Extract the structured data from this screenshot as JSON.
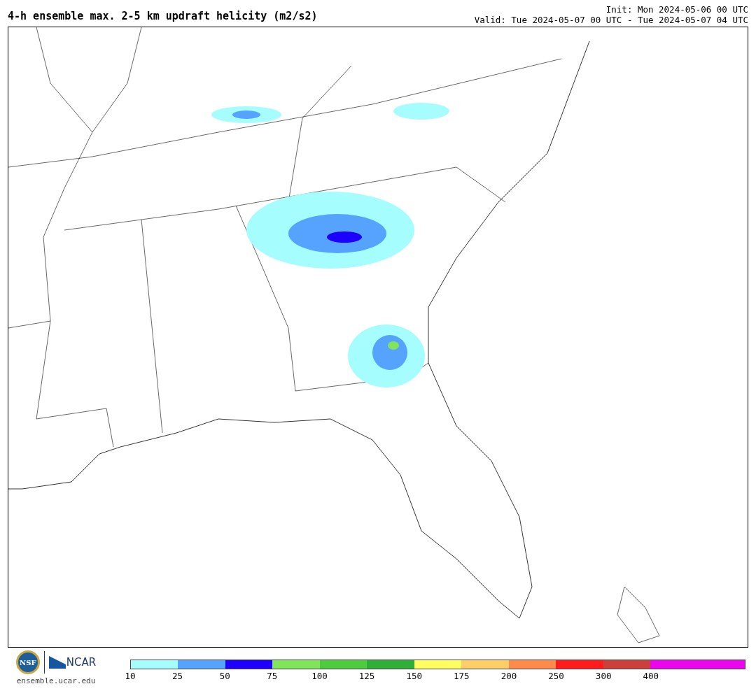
{
  "title": "4-h ensemble max. 2-5 km updraft helicity (m2/s2)",
  "init": "Init: Mon 2024-05-06 00 UTC",
  "valid": "Valid: Tue 2024-05-07 00 UTC - Tue 2024-05-07 04 UTC",
  "logos": {
    "nsf": "NSF",
    "ncar": "NCAR",
    "url": "ensemble.ucar.edu"
  },
  "colorbar": [
    {
      "label": "10",
      "color": "#a5fdfe"
    },
    {
      "label": "25",
      "color": "#55a2ff"
    },
    {
      "label": "50",
      "color": "#1d00ff"
    },
    {
      "label": "75",
      "color": "#80e55a"
    },
    {
      "label": "100",
      "color": "#4fcb3f"
    },
    {
      "label": "125",
      "color": "#2faf38"
    },
    {
      "label": "150",
      "color": "#fefe62"
    },
    {
      "label": "175",
      "color": "#fece69"
    },
    {
      "label": "200",
      "color": "#fe8b4c"
    },
    {
      "label": "250",
      "color": "#fe1c1c"
    },
    {
      "label": "300",
      "color": "#cb403d"
    },
    {
      "label": "400",
      "color": "#ec06ee"
    },
    {
      "color": "#ec06ee"
    }
  ]
}
